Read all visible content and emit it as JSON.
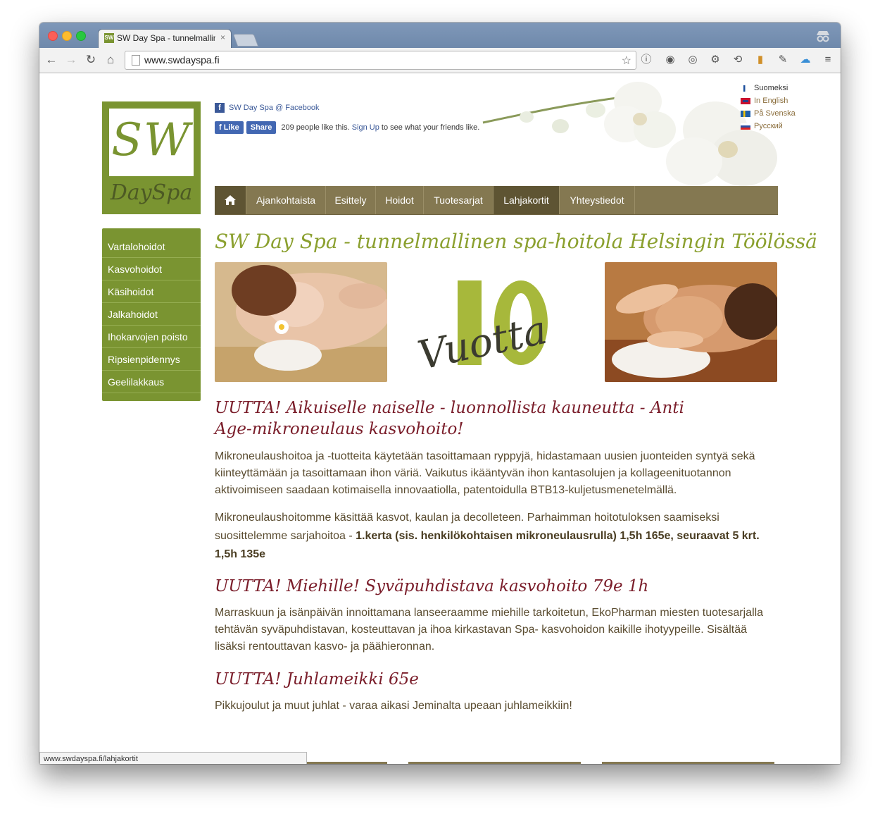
{
  "browser": {
    "tab_title": "SW Day Spa - tunnelmallin",
    "tab_favicon": "SW",
    "tab_close": "×",
    "url": "www.swdayspa.fi",
    "status_url": "www.swdayspa.fi/lahjakortit"
  },
  "facebook": {
    "page_link": "SW Day Spa @ Facebook",
    "like_label": "Like",
    "share_label": "Share",
    "like_text": "209 people like this.",
    "signup_label": "Sign Up",
    "signup_suffix": "to see what your friends like."
  },
  "languages": [
    {
      "label": "Suomeksi",
      "flag": "finland"
    },
    {
      "label": "In English",
      "flag": "uk"
    },
    {
      "label": "På Svenska",
      "flag": "sweden"
    },
    {
      "label": "Русский",
      "flag": "russia"
    }
  ],
  "logo": {
    "top": "SW",
    "bottom": "DaySpa"
  },
  "nav": {
    "home_icon": "home-icon",
    "items": [
      "Ajankohtaista",
      "Esittely",
      "Hoidot",
      "Tuotesarjat",
      "Lahjakortit",
      "Yhteystiedot"
    ],
    "active": "Lahjakortit"
  },
  "sidebar": [
    "Vartalohoidot",
    "Kasvohoidot",
    "Käsihoidot",
    "Jalkahoidot",
    "Ihokarvojen poisto",
    "Ripsienpidennys",
    "Geelilakkaus"
  ],
  "main": {
    "title": "SW Day Spa - tunnelmallinen spa-hoitola Helsingin Töölössä",
    "anniversary_number": "10",
    "anniversary_word": "Vuotta",
    "news": [
      {
        "heading": "UUTTA! Aikuiselle naiselle - luonnollista kauneutta - Anti Age-mikroneulaus kasvohoito!",
        "paragraphs": [
          "Mikroneulaushoitoa ja -tuotteita käytetään tasoittamaan ryppyjä, hidastamaan uusien juonteiden syntyä sekä kiinteyttämään ja tasoittamaan ihon väriä. Vaikutus ikääntyvän ihon kantasolujen ja kollageenituotannon aktivoimiseen saadaan kotimaisella innovaatiolla, patentoidulla BTB13-kuljetusmenetelmällä."
        ],
        "p2_text": "Mikroneulaushoitomme käsittää kasvot, kaulan ja decolleteen. Parhaimman hoitotuloksen saamiseksi suosittelemme sarjahoitoa - ",
        "p2_bold": "1.kerta (sis. henkilökohtaisen mikroneulausrulla) 1,5h 165e, seuraavat 5 krt. 1,5h 135e"
      },
      {
        "heading": "UUTTA! Miehille! Syväpuhdistava kasvohoito 79e 1h",
        "text": "Marraskuun ja isänpäivän innoittamana lanseeraamme miehille tarkoitetun, EkoPharman miesten tuotesarjalla tehtävän syväpuhdistavan, kosteuttavan ja ihoa kirkastavan Spa- kasvohoidon kaikille ihotyypeille. Sisältää lisäksi rentouttavan kasvo- ja päähieronnan."
      },
      {
        "heading": "UUTTA! Juhlameikki 65e",
        "text": "Pikkujoulut ja muut juhlat -  varaa aikasi Jeminalta upeaan juhlameikkiin!"
      }
    ]
  },
  "colors": {
    "brand_green": "#7a9431",
    "nav_brown": "#847851",
    "heading_red": "#7a1d2a",
    "title_green": "#8ba02f"
  }
}
